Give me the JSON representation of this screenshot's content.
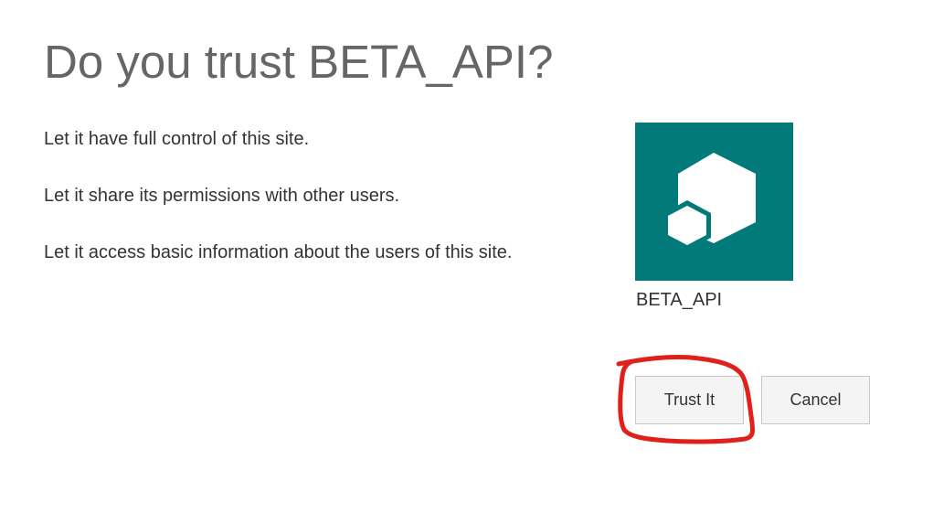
{
  "dialog": {
    "title": "Do you trust BETA_API?",
    "permissions": [
      "Let it have full control of this site.",
      "Let it share its permissions with other users.",
      "Let it access basic information about the users of this site."
    ],
    "app": {
      "name": "BETA_API",
      "icon": "hexagon-app-icon",
      "tile_color": "#037a7a"
    },
    "buttons": {
      "trust_label": "Trust It",
      "cancel_label": "Cancel"
    },
    "annotation_color": "#e0201b"
  }
}
